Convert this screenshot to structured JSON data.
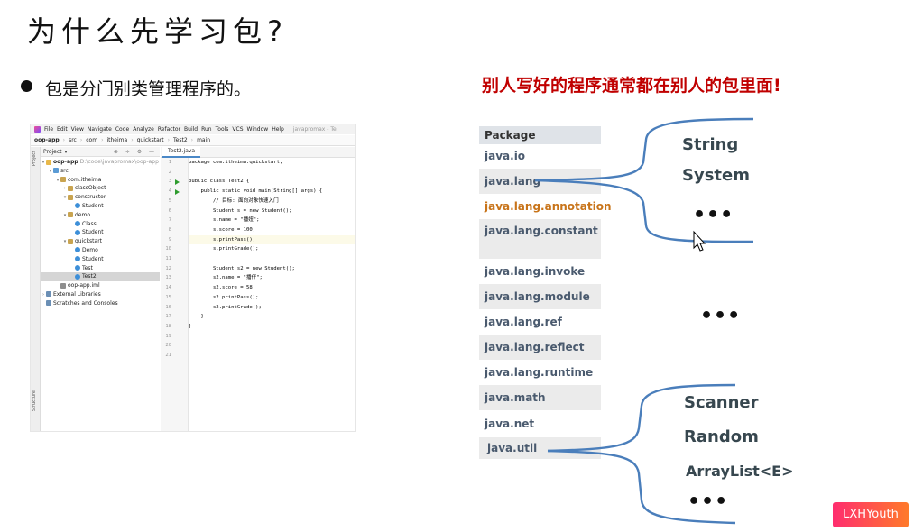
{
  "slide": {
    "title": "为什么先学习包?",
    "bullet": "包是分门别类管理程序的。",
    "note": "别人写好的程序通常都在别人的包里面!"
  },
  "ide": {
    "menu": [
      "File",
      "Edit",
      "View",
      "Navigate",
      "Code",
      "Analyze",
      "Refactor",
      "Build",
      "Run",
      "Tools",
      "VCS",
      "Window",
      "Help"
    ],
    "window_title": "javapromax - Te",
    "breadcrumbs": [
      "oop-app",
      "src",
      "com",
      "itheima",
      "quickstart",
      "Test2",
      "main"
    ],
    "project_panel_label": "Project",
    "side_tabs": {
      "project": "Project",
      "structure": "Structure"
    },
    "editor_tab": "Test2.java",
    "tree": [
      {
        "arrow": "▾",
        "icon": "folder",
        "label": "oop-app",
        "hint": "D:\\code\\javapromax\\oop-app",
        "bold": true
      },
      {
        "arrow": "▾",
        "icon": "src",
        "label": "src"
      },
      {
        "arrow": "▾",
        "icon": "pkg",
        "label": "com.itheima"
      },
      {
        "arrow": "›",
        "icon": "pkg",
        "label": "classObject"
      },
      {
        "arrow": "▾",
        "icon": "pkg",
        "label": "constructor"
      },
      {
        "arrow": "",
        "icon": "cls",
        "label": "Student"
      },
      {
        "arrow": "▾",
        "icon": "pkg",
        "label": "demo"
      },
      {
        "arrow": "",
        "icon": "cls",
        "label": "Class"
      },
      {
        "arrow": "",
        "icon": "cls",
        "label": "Student"
      },
      {
        "arrow": "▾",
        "icon": "pkg",
        "label": "quickstart"
      },
      {
        "arrow": "",
        "icon": "cls",
        "label": "Demo"
      },
      {
        "arrow": "",
        "icon": "cls",
        "label": "Student"
      },
      {
        "arrow": "",
        "icon": "cls",
        "label": "Test"
      },
      {
        "arrow": "",
        "icon": "cls",
        "label": "Test2",
        "selected": true
      },
      {
        "arrow": "",
        "icon": "iml",
        "label": "oop-app.iml"
      },
      {
        "arrow": "›",
        "icon": "lib",
        "label": "External Libraries"
      },
      {
        "arrow": "",
        "icon": "lib",
        "label": "Scratches and Consoles"
      }
    ],
    "code_lines": [
      "package com.itheima.quickstart;",
      "",
      "public class Test2 {",
      "    public static void main(String[] args) {",
      "        // 目标: 面向对象快速入门",
      "        Student s = new Student();",
      "        s.name = \"播妞\";",
      "        s.score = 100;",
      "        s.printPass();",
      "        s.printGrade();",
      "",
      "        Student s2 = new Student();",
      "        s2.name = \"播仔\";",
      "        s2.score = 58;",
      "        s2.printPass();",
      "        s2.printGrade();",
      "    }",
      "}",
      "",
      "",
      ""
    ],
    "highlighted_line": 9
  },
  "packages": {
    "header": "Package",
    "items": [
      "java.io",
      "java.lang",
      "java.lang.annotation",
      "java.lang.constant",
      "java.lang.invoke",
      "java.lang.module",
      "java.lang.ref",
      "java.lang.reflect",
      "java.lang.runtime",
      "java.math",
      "java.net",
      "java.util"
    ],
    "highlight_color": "#c8741a"
  },
  "lang_classes": [
    "String",
    "System",
    "•••"
  ],
  "middle_dots": "•••",
  "util_classes": [
    "Scanner",
    "Random",
    "ArrayList<E>",
    "•••"
  ],
  "watermark": "LXHYouth"
}
